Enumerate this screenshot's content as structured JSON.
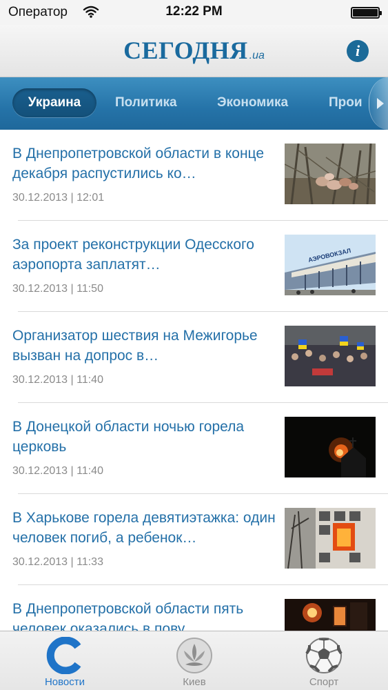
{
  "status_bar": {
    "carrier": "Оператор",
    "time": "12:22 PM"
  },
  "header": {
    "logo_main": "СЕГОДНЯ",
    "logo_suffix": ".ua",
    "info_icon": "info-icon",
    "info_label": "i"
  },
  "tabs": [
    {
      "label": "Украина",
      "active": true
    },
    {
      "label": "Политика",
      "active": false
    },
    {
      "label": "Экономика",
      "active": false
    },
    {
      "label": "Прои",
      "active": false
    }
  ],
  "news": [
    {
      "title": "В Днепропетровской области в конце декабря распустились ко…",
      "date": "30.12.2013 | 12:01",
      "thumb": "blossom-branches-photo"
    },
    {
      "title": "За проект реконструкции Одесского аэропорта заплатят…",
      "date": "30.12.2013 | 11:50",
      "thumb": "airport-building-photo"
    },
    {
      "title": "Организатор шествия на Межигорье вызван на допрос в…",
      "date": "30.12.2013 | 11:40",
      "thumb": "crowd-march-photo"
    },
    {
      "title": "В Донецкой области ночью горела церковь",
      "date": "30.12.2013 | 11:40",
      "thumb": "burning-church-photo"
    },
    {
      "title": "В Харькове горела девятиэтажка: один человек погиб, а ребенок…",
      "date": "30.12.2013 | 11:33",
      "thumb": "burning-building-photo"
    },
    {
      "title": "В Днепропетровской области пять человек оказались в пову…",
      "date": "",
      "thumb": "fire-night-photo"
    }
  ],
  "tab_bar": [
    {
      "label": "Новости",
      "icon": "news-c-icon",
      "active": true
    },
    {
      "label": "Киев",
      "icon": "kyiv-emblem-icon",
      "active": false
    },
    {
      "label": "Спорт",
      "icon": "soccer-ball-icon",
      "active": false
    }
  ],
  "colors": {
    "brand_blue": "#1a6a9e",
    "tab_bar_active": "#1f74c8",
    "news_title": "#2470a8"
  }
}
